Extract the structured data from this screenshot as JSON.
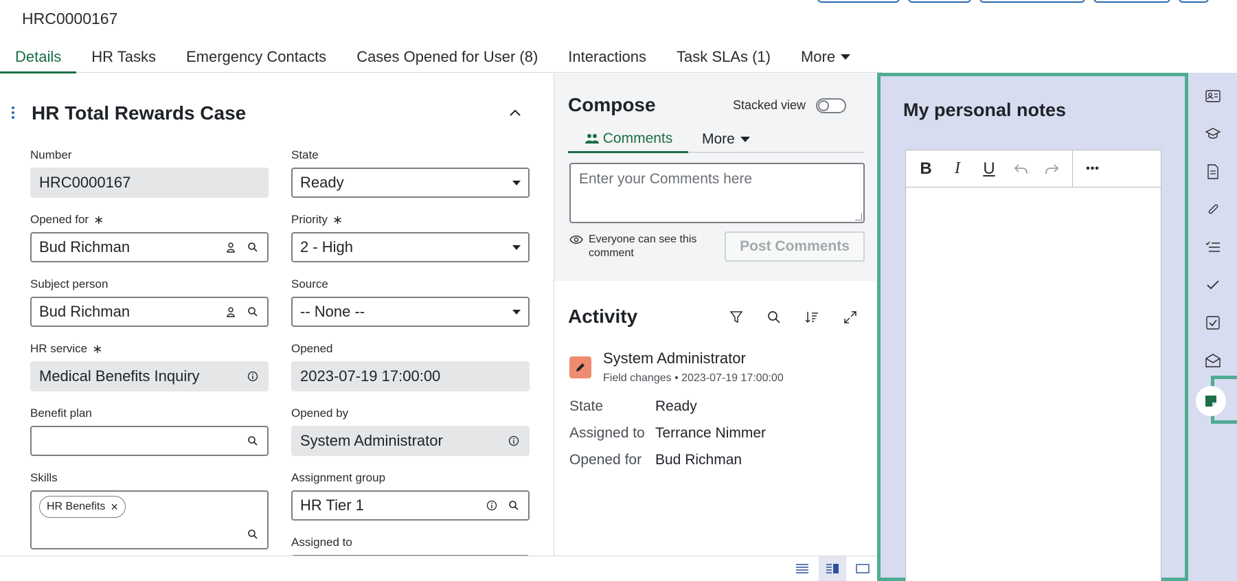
{
  "record": {
    "number": "HRC0000167"
  },
  "tabs": [
    {
      "label": "Details",
      "active": true
    },
    {
      "label": "HR Tasks"
    },
    {
      "label": "Emergency Contacts"
    },
    {
      "label": "Cases Opened for User (8)"
    },
    {
      "label": "Interactions"
    },
    {
      "label": "Task SLAs (1)"
    },
    {
      "label": "More"
    }
  ],
  "form": {
    "title": "HR Total Rewards Case",
    "required_mark": "∗",
    "fields": {
      "number": {
        "label": "Number",
        "value": "HRC0000167"
      },
      "state": {
        "label": "State",
        "value": "Ready"
      },
      "opened_for": {
        "label": "Opened for",
        "value": "Bud Richman"
      },
      "priority": {
        "label": "Priority",
        "value": "2 - High"
      },
      "subject_person": {
        "label": "Subject person",
        "value": "Bud Richman"
      },
      "source": {
        "label": "Source",
        "value": "-- None --"
      },
      "hr_service": {
        "label": "HR service",
        "value": "Medical Benefits Inquiry"
      },
      "opened": {
        "label": "Opened",
        "value": "2023-07-19 17:00:00"
      },
      "benefit_plan": {
        "label": "Benefit plan",
        "value": ""
      },
      "opened_by": {
        "label": "Opened by",
        "value": "System Administrator"
      },
      "skills": {
        "label": "Skills",
        "chips": [
          "HR Benefits"
        ]
      },
      "assignment_group": {
        "label": "Assignment group",
        "value": "HR Tier 1"
      },
      "assigned_to": {
        "label": "Assigned to"
      }
    }
  },
  "compose": {
    "title": "Compose",
    "stacked_view_label": "Stacked view",
    "stacked_view_on": false,
    "tabs": {
      "comments": "Comments",
      "more": "More"
    },
    "comment_placeholder": "Enter your Comments here",
    "visibility_note": "Everyone can see this comment",
    "post_button": "Post Comments"
  },
  "activity": {
    "title": "Activity",
    "entries": [
      {
        "author": "System Administrator",
        "type": "Field changes",
        "separator": "•",
        "timestamp": "2023-07-19 17:00:00",
        "changes": [
          {
            "field": "State",
            "value": "Ready"
          },
          {
            "field": "Assigned to",
            "value": "Terrance Nimmer"
          },
          {
            "field": "Opened for",
            "value": "Bud Richman"
          }
        ]
      }
    ]
  },
  "notes": {
    "title": "My personal notes",
    "toolbar": {
      "bold": "B",
      "italic": "I",
      "underline": "U",
      "more": "•••"
    }
  },
  "sidebar": {
    "icons": [
      "contact-card-icon",
      "graduation-cap-icon",
      "document-icon",
      "paperclip-icon",
      "checklist-icon",
      "checkmark-icon",
      "checkbox-icon",
      "envelope-icon",
      "sticky-note-icon"
    ],
    "active": "sticky-note-icon"
  },
  "colors": {
    "accent_green": "#1b6e46",
    "highlight_teal": "#4fac93",
    "sidebar_lavender": "#d8dcf0",
    "activity_avatar": "#ef8b70",
    "link_blue": "#2c6bb0"
  }
}
